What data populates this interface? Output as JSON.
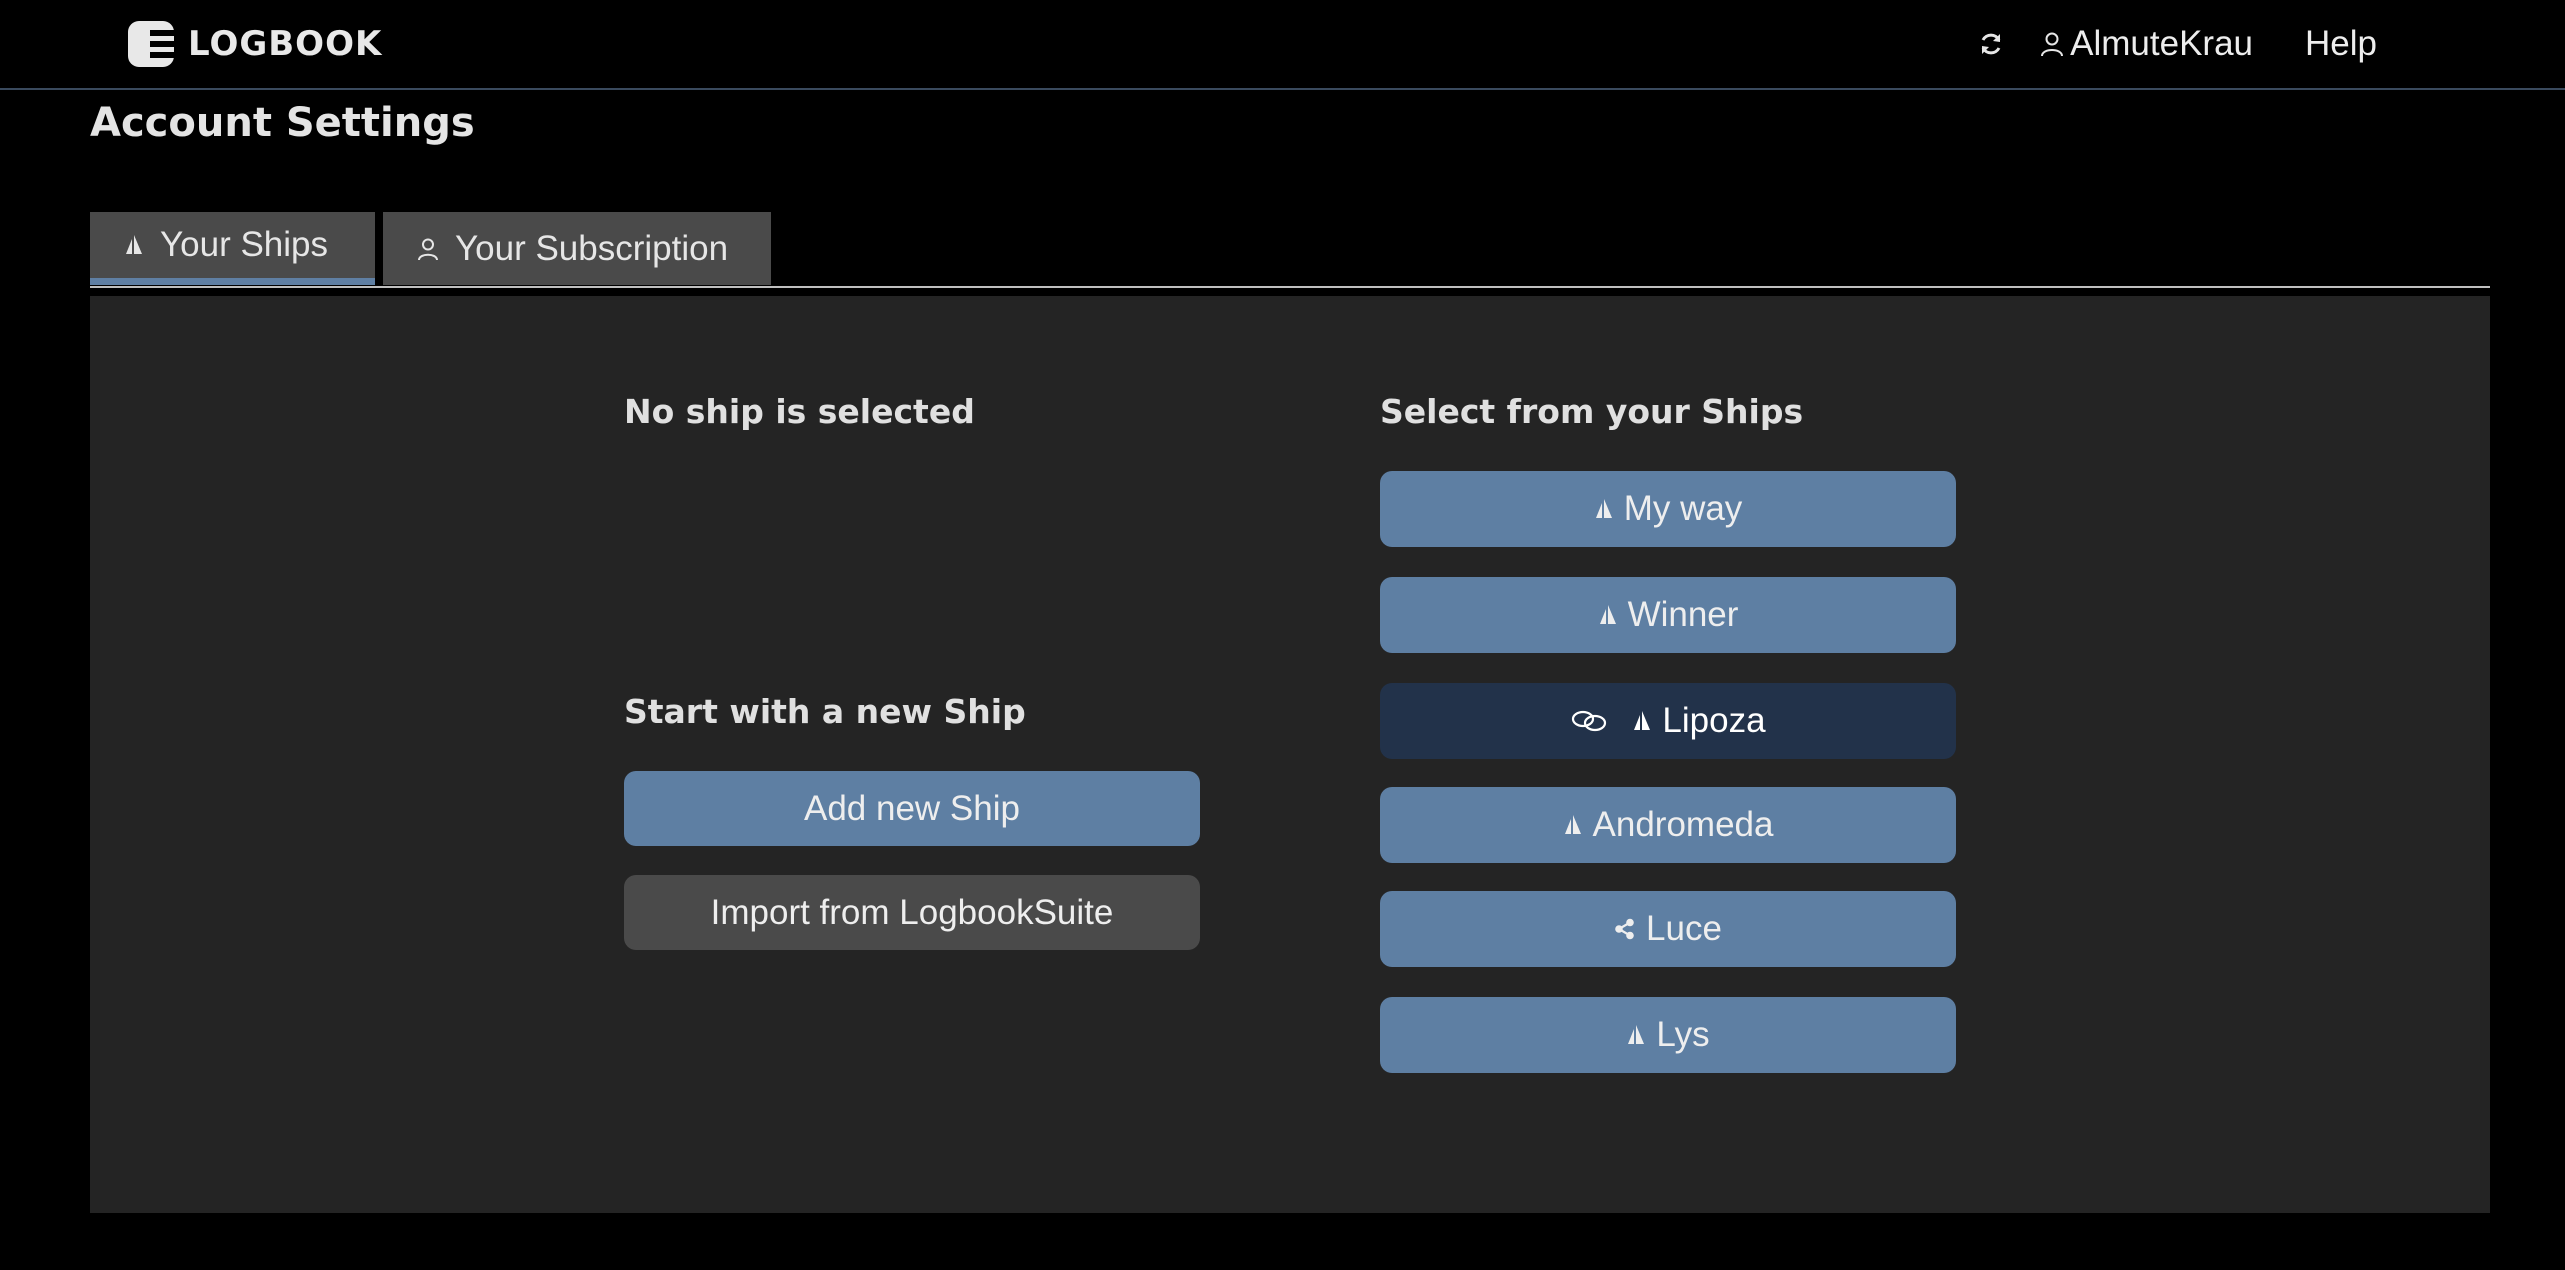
{
  "header": {
    "brand": "LOGBOOK",
    "user_name": "AlmuteKrau",
    "help_label": "Help"
  },
  "page": {
    "title": "Account Settings"
  },
  "tabs": [
    {
      "label": "Your Ships",
      "icon": "sail-icon",
      "active": true
    },
    {
      "label": "Your Subscription",
      "icon": "user-icon",
      "active": false
    }
  ],
  "left_column": {
    "no_ship_text": "No ship is selected",
    "new_ship_heading": "Start with a new Ship",
    "add_button_label": "Add new Ship",
    "import_button_label": "Import from LogbookSuite"
  },
  "right_column": {
    "heading": "Select from your Ships",
    "ships": [
      {
        "name": "My way",
        "icon": "sail-icon",
        "selected": false
      },
      {
        "name": "Winner",
        "icon": "sail-icon",
        "selected": false
      },
      {
        "name": "Lipoza",
        "icon": "sail-icon",
        "linked": true,
        "selected": true
      },
      {
        "name": "Andromeda",
        "icon": "sail-icon",
        "selected": false
      },
      {
        "name": "Luce",
        "icon": "share-icon",
        "selected": false
      },
      {
        "name": "Lys",
        "icon": "sail-icon",
        "selected": false
      }
    ]
  },
  "colors": {
    "accent": "#5e7fa3",
    "selected": "#22324a",
    "panel": "#242424",
    "tab_bg": "#4a4a4a"
  }
}
